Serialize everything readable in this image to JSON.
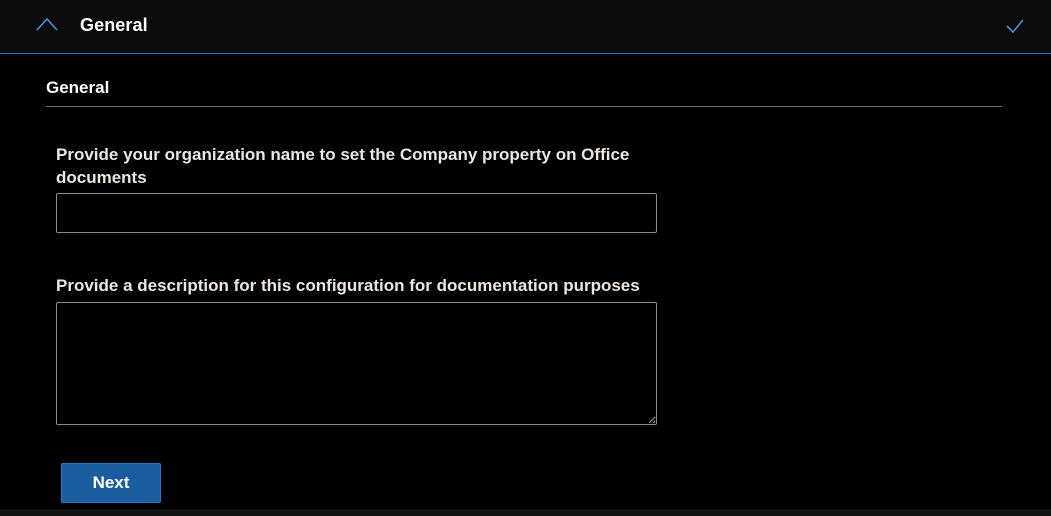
{
  "header": {
    "title": "General",
    "expanded_icon": "chevron-up-icon",
    "status_icon": "checkmark-icon",
    "accent_color": "#2f6fb0"
  },
  "section": {
    "title": "General"
  },
  "fields": {
    "organization": {
      "label": "Provide your organization name to set the Company property on Office documents",
      "value": "",
      "placeholder": ""
    },
    "description": {
      "label": "Provide a description for this configuration for documentation purposes",
      "value": "",
      "placeholder": ""
    }
  },
  "actions": {
    "next_label": "Next",
    "next_color": "#1a5e9f"
  }
}
